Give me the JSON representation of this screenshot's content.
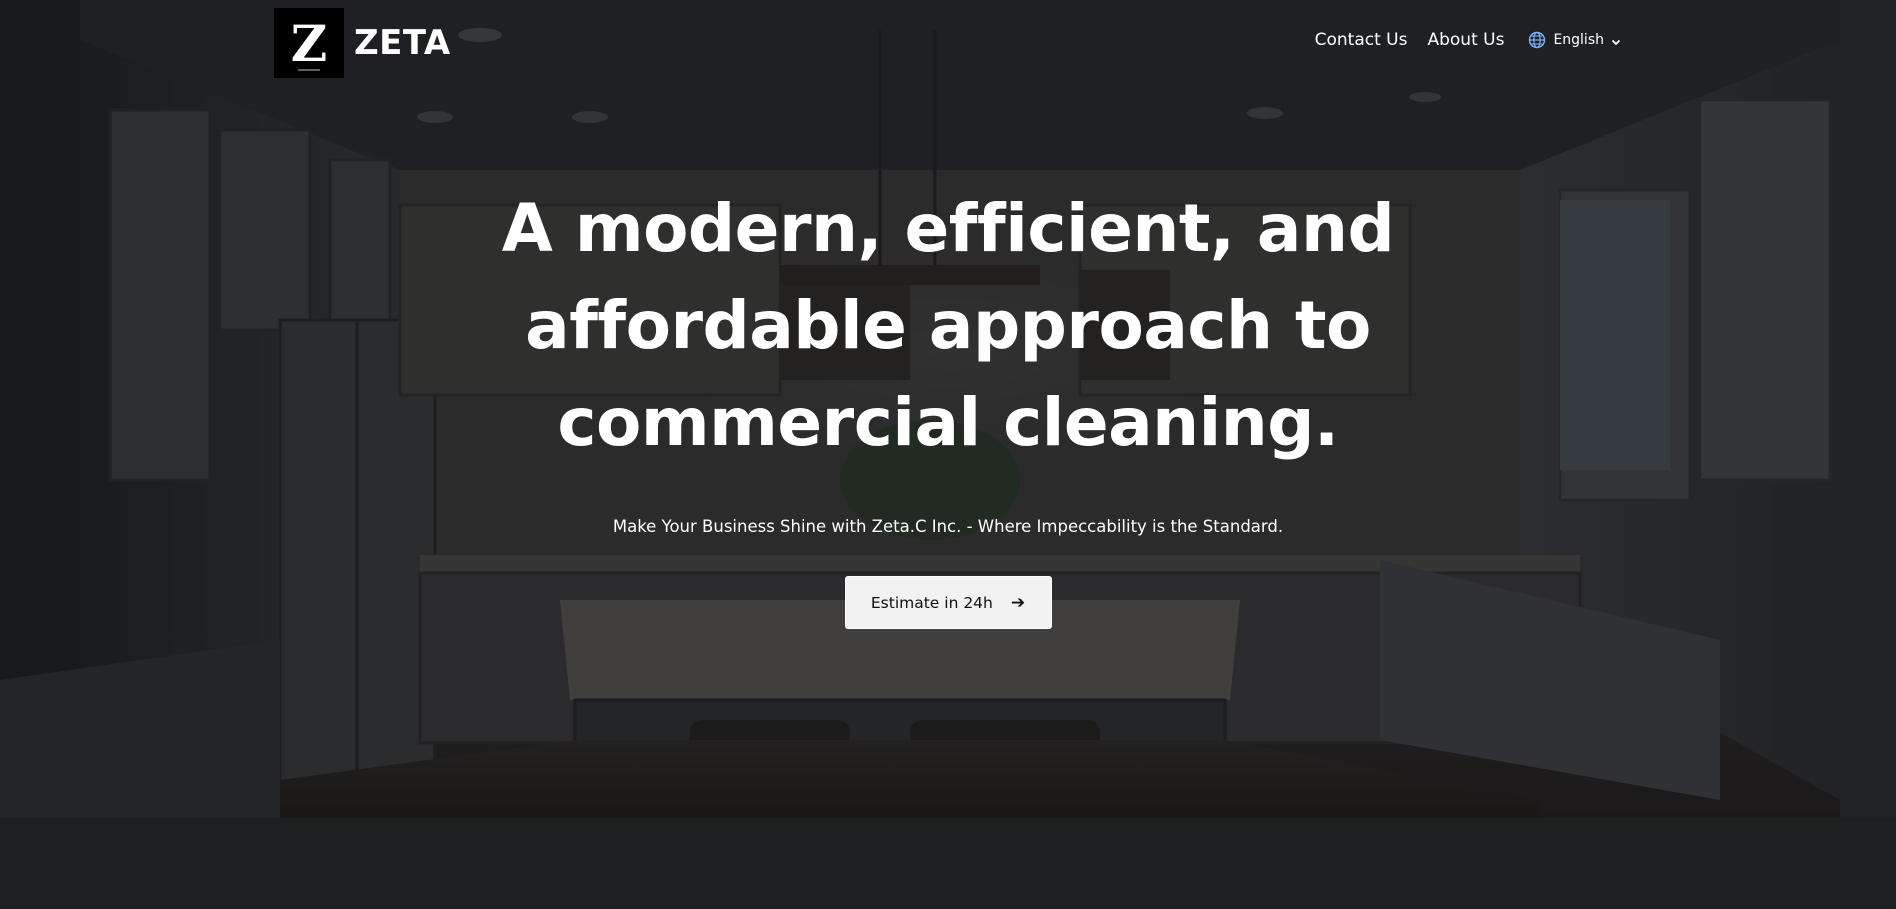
{
  "header": {
    "brand": "ZETA",
    "logo_letter": "Z",
    "nav": {
      "contact": "Contact Us",
      "about": "About Us",
      "language": "English"
    }
  },
  "hero": {
    "headline": "A modern, efficient, and affordable approach to commercial cleaning.",
    "subline": "Make Your Business Shine with Zeta.C Inc. - Where Impeccability is the Standard.",
    "cta_label": "Estimate in 24h",
    "cta_arrow": "➔"
  },
  "icons": {
    "language": "globe-icon",
    "dropdown": "chevron-down-icon",
    "cta": "arrow-right-icon"
  },
  "colors": {
    "text": "#ffffff",
    "cta_bg": "#f2f2f2",
    "cta_text": "#111111",
    "footer_band": "#1d2020"
  }
}
